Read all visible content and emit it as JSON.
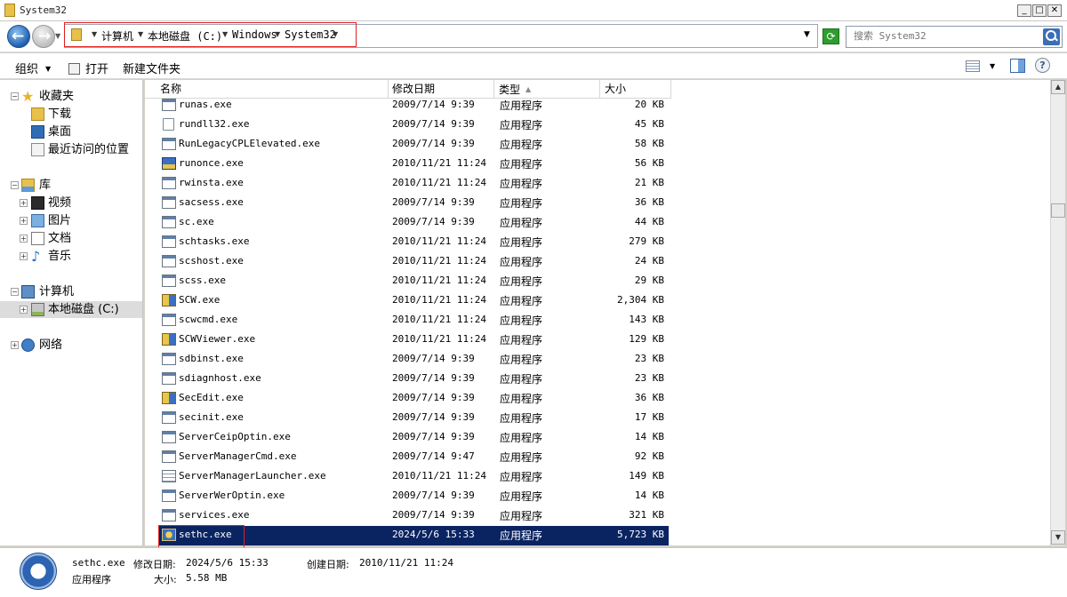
{
  "window": {
    "title": "System32"
  },
  "address": {
    "breadcrumbs": [
      "计算机",
      "本地磁盘 (C:)",
      "Windows",
      "System32"
    ],
    "search_placeholder": "搜索 System32"
  },
  "toolbar": {
    "organize": "组织",
    "open": "打开",
    "new_folder": "新建文件夹"
  },
  "nav": {
    "favorites": {
      "label": "收藏夹",
      "items": [
        "下载",
        "桌面",
        "最近访问的位置"
      ]
    },
    "libraries": {
      "label": "库",
      "items": [
        "视频",
        "图片",
        "文档",
        "音乐"
      ]
    },
    "computer": {
      "label": "计算机",
      "items": [
        "本地磁盘 (C:)"
      ]
    },
    "network": {
      "label": "网络"
    }
  },
  "columns": {
    "name": "名称",
    "date": "修改日期",
    "type": "类型",
    "size": "大小"
  },
  "files": [
    {
      "icon": "app",
      "name": "runas.exe",
      "date": "2009/7/14 9:39",
      "type": "应用程序",
      "size": "20 KB"
    },
    {
      "icon": "doc",
      "name": "rundll32.exe",
      "date": "2009/7/14 9:39",
      "type": "应用程序",
      "size": "45 KB"
    },
    {
      "icon": "app",
      "name": "RunLegacyCPLElevated.exe",
      "date": "2009/7/14 9:39",
      "type": "应用程序",
      "size": "58 KB"
    },
    {
      "icon": "runonce",
      "name": "runonce.exe",
      "date": "2010/11/21 11:24",
      "type": "应用程序",
      "size": "56 KB"
    },
    {
      "icon": "app",
      "name": "rwinsta.exe",
      "date": "2010/11/21 11:24",
      "type": "应用程序",
      "size": "21 KB"
    },
    {
      "icon": "app",
      "name": "sacsess.exe",
      "date": "2009/7/14 9:39",
      "type": "应用程序",
      "size": "36 KB"
    },
    {
      "icon": "app",
      "name": "sc.exe",
      "date": "2009/7/14 9:39",
      "type": "应用程序",
      "size": "44 KB"
    },
    {
      "icon": "app",
      "name": "schtasks.exe",
      "date": "2010/11/21 11:24",
      "type": "应用程序",
      "size": "279 KB"
    },
    {
      "icon": "app",
      "name": "scshost.exe",
      "date": "2010/11/21 11:24",
      "type": "应用程序",
      "size": "24 KB"
    },
    {
      "icon": "app",
      "name": "scss.exe",
      "date": "2010/11/21 11:24",
      "type": "应用程序",
      "size": "29 KB"
    },
    {
      "icon": "shield",
      "name": "SCW.exe",
      "date": "2010/11/21 11:24",
      "type": "应用程序",
      "size": "2,304 KB"
    },
    {
      "icon": "app",
      "name": "scwcmd.exe",
      "date": "2010/11/21 11:24",
      "type": "应用程序",
      "size": "143 KB"
    },
    {
      "icon": "shield",
      "name": "SCWViewer.exe",
      "date": "2010/11/21 11:24",
      "type": "应用程序",
      "size": "129 KB"
    },
    {
      "icon": "app",
      "name": "sdbinst.exe",
      "date": "2009/7/14 9:39",
      "type": "应用程序",
      "size": "23 KB"
    },
    {
      "icon": "app",
      "name": "sdiagnhost.exe",
      "date": "2009/7/14 9:39",
      "type": "应用程序",
      "size": "23 KB"
    },
    {
      "icon": "shield",
      "name": "SecEdit.exe",
      "date": "2009/7/14 9:39",
      "type": "应用程序",
      "size": "36 KB"
    },
    {
      "icon": "app",
      "name": "secinit.exe",
      "date": "2009/7/14 9:39",
      "type": "应用程序",
      "size": "17 KB"
    },
    {
      "icon": "app",
      "name": "ServerCeipOptin.exe",
      "date": "2009/7/14 9:39",
      "type": "应用程序",
      "size": "14 KB"
    },
    {
      "icon": "app",
      "name": "ServerManagerCmd.exe",
      "date": "2009/7/14 9:47",
      "type": "应用程序",
      "size": "92 KB"
    },
    {
      "icon": "stack",
      "name": "ServerManagerLauncher.exe",
      "date": "2010/11/21 11:24",
      "type": "应用程序",
      "size": "149 KB"
    },
    {
      "icon": "app",
      "name": "ServerWerOptin.exe",
      "date": "2009/7/14 9:39",
      "type": "应用程序",
      "size": "14 KB"
    },
    {
      "icon": "app",
      "name": "services.exe",
      "date": "2009/7/14 9:39",
      "type": "应用程序",
      "size": "321 KB"
    },
    {
      "icon": "sethc",
      "name": "sethc.exe",
      "date": "2024/5/6 15:33",
      "type": "应用程序",
      "size": "5,723 KB",
      "selected": true
    }
  ],
  "details": {
    "name": "sethc.exe",
    "modified_label": "修改日期:",
    "modified": "2024/5/6 15:33",
    "created_label": "创建日期:",
    "created": "2010/11/21 11:24",
    "type": "应用程序",
    "size_label": "大小:",
    "size": "5.58 MB"
  }
}
